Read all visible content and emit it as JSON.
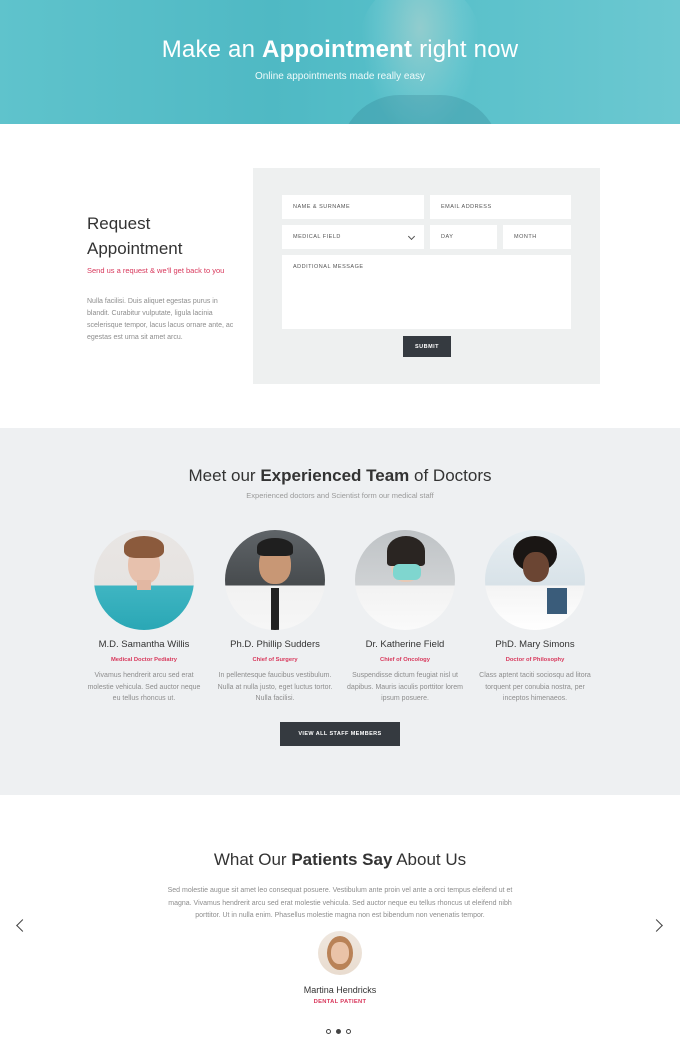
{
  "hero": {
    "title_pre": "Make an ",
    "title_bold": "Appointment",
    "title_post": " right now",
    "subtitle": "Online appointments made really easy"
  },
  "request": {
    "title_line1": "Request",
    "title_line2": "Appointment",
    "subtitle": "Send us a request & we'll get back to you",
    "body": "Nulla facilisi. Duis aliquet egestas purus in blandit. Curabitur vulputate, ligula lacinia scelerisque tempor, lacus lacus ornare ante, ac egestas est urna sit amet arcu."
  },
  "form": {
    "name_placeholder": "NAME & SURNAME",
    "email_placeholder": "EMAIL ADDRESS",
    "field_select": "MEDICAL FIELD",
    "day_placeholder": "DAY",
    "month_placeholder": "MONTH",
    "message_placeholder": "ADDITIONAL MESSAGE",
    "submit_label": "SUBMIT"
  },
  "team": {
    "title_pre": "Meet our ",
    "title_bold": "Experienced Team",
    "title_post": " of Doctors",
    "subtitle": "Experienced doctors and Scientist form our medical staff",
    "doctors": [
      {
        "name": "M.D. Samantha Willis",
        "role": "Medical Doctor Pediatry",
        "text": "Vivamus hendrerit arcu sed erat molestie vehicula. Sed auctor neque eu tellus rhoncus ut."
      },
      {
        "name": "Ph.D. Phillip Sudders",
        "role": "Chief of Surgery",
        "text": "In pellentesque faucibus vestibulum. Nulla at nulla justo, eget luctus tortor. Nulla facilisi."
      },
      {
        "name": "Dr. Katherine Field",
        "role": "Chief of Oncology",
        "text": "Suspendisse dictum feugiat nisl ut dapibus. Mauris iaculis porttitor lorem ipsum posuere."
      },
      {
        "name": "PhD. Mary Simons",
        "role": "Doctor of Philosophy",
        "text": "Class aptent taciti sociosqu ad litora torquent per conubia nostra, per inceptos himenaeos."
      }
    ],
    "staff_button": "VIEW ALL STAFF MEMBERS"
  },
  "testimonials": {
    "title_pre": "What Our ",
    "title_bold": "Patients Say",
    "title_post": " About Us",
    "quote": "Sed molestie augue sit amet leo consequat posuere. Vestibulum ante proin vel ante a orci tempus eleifend ut et magna. Vivamus hendrerit arcu sed erat molestie vehicula. Sed auctor neque eu tellus rhoncus ut eleifend nibh porttitor. Ut in nulla enim. Phasellus molestie magna non est bibendum non venenatis tempor.",
    "patient_name": "Martina Hendricks",
    "patient_role": "DENTAL PATIENT",
    "active_slide": 2,
    "slide_count": 3
  },
  "colors": {
    "accent": "#d8375b",
    "hero": "#56bfc9",
    "button_dark": "#353a40",
    "section_gray": "#eef0f2"
  },
  "icons": {
    "prev": "chevron-left-icon",
    "next": "chevron-right-icon",
    "select": "chevron-down-icon"
  }
}
